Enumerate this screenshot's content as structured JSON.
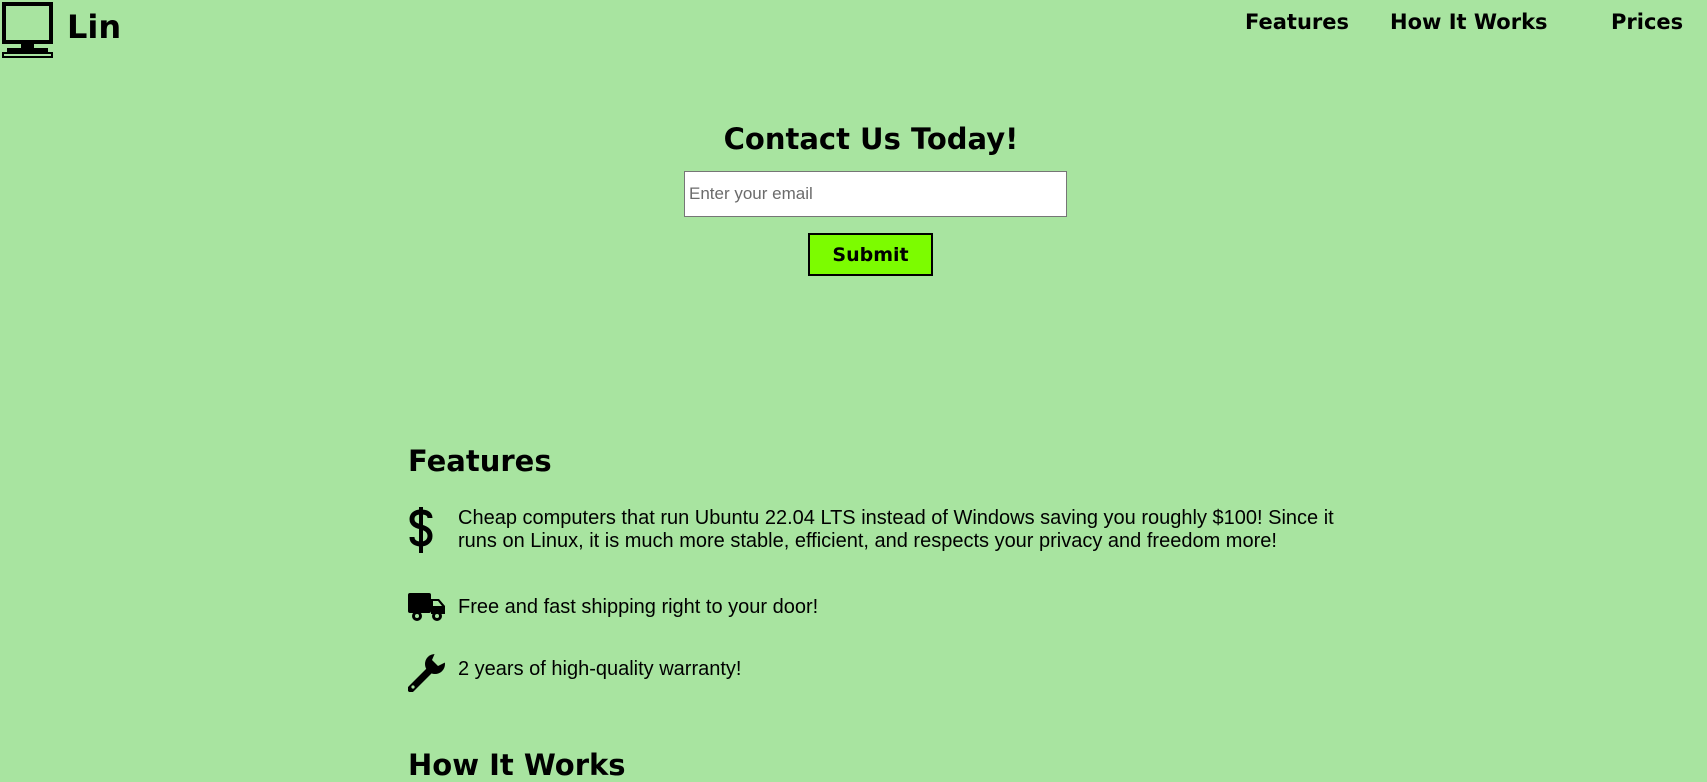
{
  "header": {
    "brand": "Lin",
    "brand_icon": "desktop-computer-icon",
    "nav": [
      "Features",
      "How It Works",
      "Prices"
    ]
  },
  "contact": {
    "title": "Contact Us Today!",
    "email_placeholder": "Enter your email",
    "submit_label": "Submit"
  },
  "features": {
    "title": "Features",
    "items": [
      {
        "icon": "dollar-icon",
        "text": "Cheap computers that run Ubuntu 22.04 LTS instead of Windows saving you roughly $100! Since it runs on Linux, it is much more stable, efficient, and respects your privacy and freedom more!"
      },
      {
        "icon": "truck-icon",
        "text": "Free and fast shipping right to your door!"
      },
      {
        "icon": "wrench-icon",
        "text": "2 years of high-quality warranty!"
      }
    ]
  },
  "how_it_works": {
    "title": "How It Works"
  },
  "colors": {
    "background": "#a8e4a0",
    "submit_button": "#7cfc00",
    "text": "#000000"
  }
}
